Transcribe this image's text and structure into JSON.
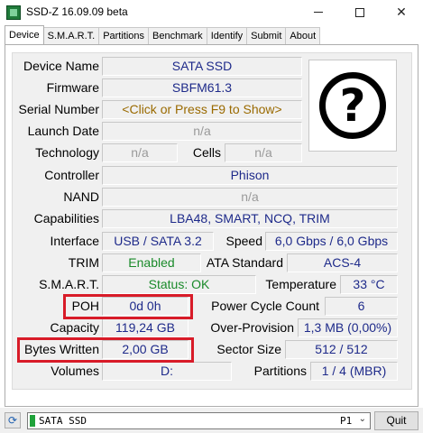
{
  "window": {
    "title": "SSD-Z 16.09.09 beta",
    "min_glyph": "",
    "close_glyph": "✕"
  },
  "tabs": [
    "Device",
    "S.M.A.R.T.",
    "Partitions",
    "Benchmark",
    "Identify",
    "Submit",
    "About"
  ],
  "active_tab": "Device",
  "device": {
    "device_name_label": "Device Name",
    "device_name": "SATA SSD",
    "firmware_label": "Firmware",
    "firmware": "SBFM61.3",
    "serial_label": "Serial Number",
    "serial": "<Click or Press F9 to Show>",
    "launch_label": "Launch Date",
    "launch": "n/a",
    "technology_label": "Technology",
    "technology": "n/a",
    "cells_label": "Cells",
    "cells": "n/a",
    "controller_label": "Controller",
    "controller": "Phison",
    "nand_label": "NAND",
    "nand": "n/a",
    "capabilities_label": "Capabilities",
    "capabilities": "LBA48, SMART, NCQ, TRIM",
    "interface_label": "Interface",
    "interface": "USB / SATA 3.2",
    "speed_label": "Speed",
    "speed": "6,0 Gbps / 6,0 Gbps",
    "trim_label": "TRIM",
    "trim": "Enabled",
    "ata_label": "ATA Standard",
    "ata": "ACS-4",
    "smart_label": "S.M.A.R.T.",
    "smart": "Status: OK",
    "temp_label": "Temperature",
    "temp": "33 °C",
    "poh_label": "POH",
    "poh": "0d 0h",
    "pcc_label": "Power Cycle Count",
    "pcc": "6",
    "capacity_label": "Capacity",
    "capacity": "119,24 GB",
    "overprov_label": "Over-Provision",
    "overprov": "1,3 MB (0,00%)",
    "bytes_label": "Bytes Written",
    "bytes": "2,00 GB",
    "sector_label": "Sector Size",
    "sector": "512 / 512",
    "volumes_label": "Volumes",
    "volumes": "D:",
    "partitions_label": "Partitions",
    "partitions": "1 / 4 (MBR)"
  },
  "unknown_logo": {
    "glyph": "?"
  },
  "bottom": {
    "drive": "SATA SSD",
    "port": "P1",
    "quit": "Quit"
  },
  "colors": {
    "value_text": "#1e2a8a",
    "dim_text": "#9a9a9a",
    "ok_text": "#1a8a2a",
    "highlight": "#d81b28"
  }
}
